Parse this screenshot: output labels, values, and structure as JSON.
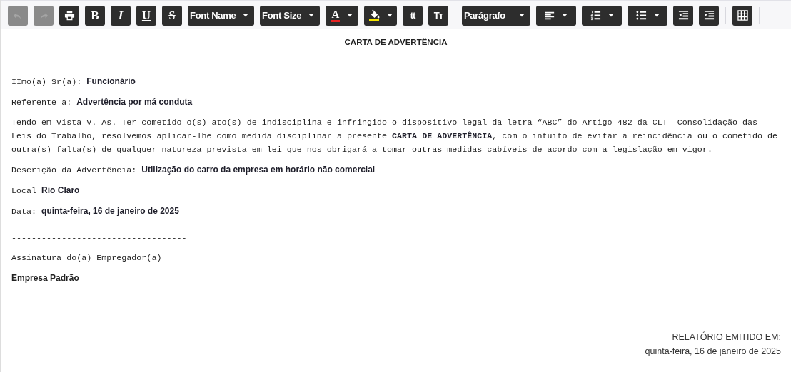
{
  "toolbar": [
    {
      "kind": "icon",
      "disabled": true
    },
    {
      "kind": "icon",
      "disabled": true
    },
    {
      "kind": "icon",
      "disabled": false
    },
    {
      "kind": "glyph",
      "label": "B",
      "disabled": false
    },
    {
      "kind": "glyph",
      "label": "I",
      "disabled": false
    },
    {
      "kind": "glyph",
      "label": "U",
      "disabled": false
    },
    {
      "kind": "glyph",
      "label": "S",
      "disabled": false
    },
    {
      "kind": "dropdown",
      "label": "Font Name",
      "disabled": false
    },
    {
      "kind": "dropdown",
      "label": "Font Size",
      "disabled": false
    },
    {
      "kind": "color",
      "label": "A",
      "color": "#e52222",
      "disabled": false
    },
    {
      "kind": "fill",
      "color": "#f4e400",
      "disabled": false
    },
    {
      "kind": "glyph",
      "label": "tt",
      "disabled": false
    },
    {
      "kind": "glyph",
      "label": "Tт",
      "disabled": false
    },
    {
      "kind": "separator"
    },
    {
      "kind": "dropdown",
      "label": "Parágrafo",
      "disabled": false
    },
    {
      "kind": "iconmenu",
      "disabled": false
    },
    {
      "kind": "iconmenu",
      "disabled": false
    },
    {
      "kind": "iconmenu",
      "disabled": false
    },
    {
      "kind": "icon",
      "disabled": false
    },
    {
      "kind": "icon",
      "disabled": false
    },
    {
      "kind": "separator"
    },
    {
      "kind": "icon",
      "disabled": false
    },
    {
      "kind": "separator"
    },
    {
      "kind": "separator"
    }
  ],
  "document": {
    "title": "CARTA DE ADVERTÊNCIA",
    "paragraphs": [
      {
        "kind": "field",
        "text": "IImo(a) Sr(a): **Funcionário**"
      },
      {
        "kind": "field",
        "text": "Referente a: **Advertência por má conduta**"
      },
      {
        "kind": "body",
        "text": "Tendo em vista V. As. Ter cometido o(s) ato(s) de indisciplina e infringido o dispositivo legal da letra “ABC” do Artigo 482 da CLT  -Consolidação das Leis do Trabalho, resolvemos aplicar-lhe como medida disciplinar a presente **CARTA DE ADVERTÊNCIA**, com o intuito de evitar a reincidência ou o cometido de outra(s) falta(s) de qualquer natureza prevista em lei que nos obrigará a tomar outras medidas cabíveis de acordo com a legislação em vigor."
      },
      {
        "kind": "field",
        "text": "Descrição da Advertência:  **Utilização do carro da empresa em horário não comercial**"
      },
      {
        "kind": "field",
        "text": "Local  **Rio Claro**"
      },
      {
        "kind": "field",
        "text": "Data: **quinta-feira, 16 de janeiro de 2025**"
      },
      {
        "kind": "signature",
        "text": "-----------------------------------"
      },
      {
        "kind": "field",
        "text": "Assinatura do(a) Empregador(a)"
      },
      {
        "kind": "company",
        "text": "Empresa Padrão"
      }
    ]
  },
  "footer": {
    "label": "RELATÓRIO EMITIDO EM:",
    "date": "quinta-feira, 16 de janeiro de 2025"
  }
}
